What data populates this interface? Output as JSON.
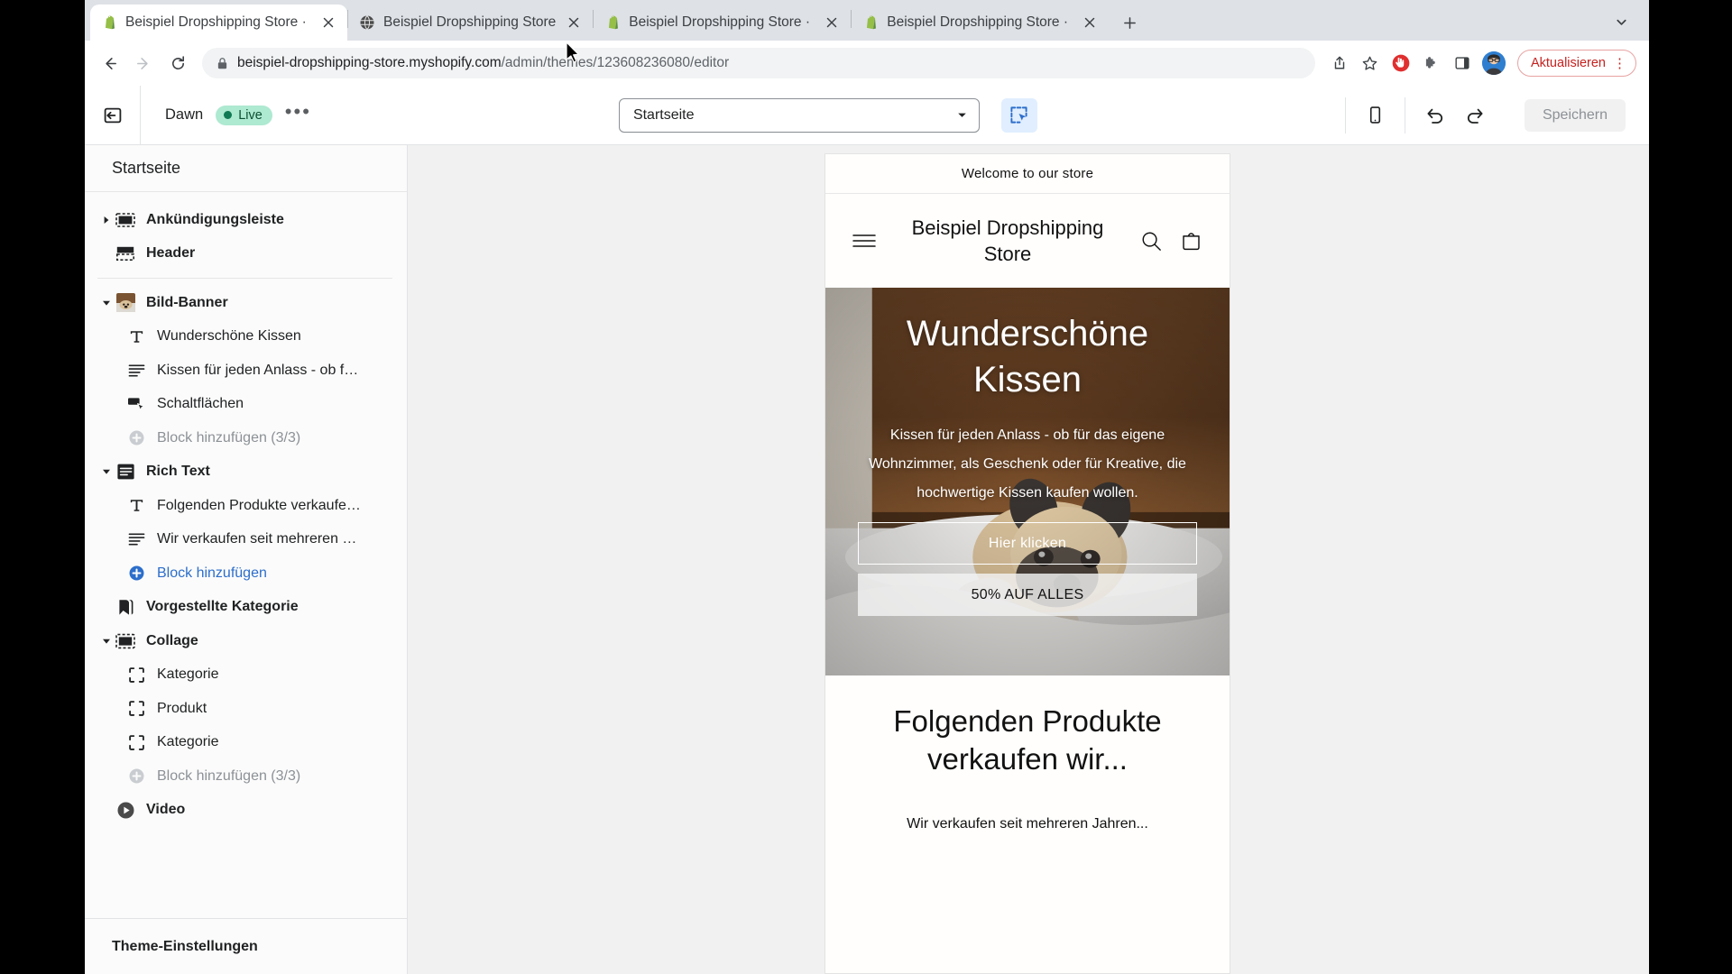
{
  "browser": {
    "tabs": [
      {
        "title": "Beispiel Dropshipping Store · D",
        "title_main": "Beispiel Dropshipping Store · ",
        "title_dim": "D",
        "favicon": "shopify-icon",
        "active": true
      },
      {
        "title": "Beispiel Dropshipping Store",
        "title_main": "Beispiel Dropshipping Store",
        "title_dim": "",
        "favicon": "globe-icon",
        "active": false
      },
      {
        "title": "Beispiel Dropshipping Store · S",
        "title_main": "Beispiel Dropshipping Store · ",
        "title_dim": "S",
        "favicon": "shopify-icon",
        "active": false
      },
      {
        "title": "Beispiel Dropshipping Store · B",
        "title_main": "Beispiel Dropshipping Store · ",
        "title_dim": "B",
        "favicon": "shopify-icon",
        "active": false
      }
    ],
    "new_tab_label": "+",
    "url_domain": "beispiel-dropshipping-store.myshopify.com",
    "url_path": "/admin/themes/123608236080/editor",
    "update_button_label": "Aktualisieren",
    "kebab_label": "⋮",
    "icons": {
      "back": "back-arrow-icon",
      "forward": "forward-arrow-icon",
      "reload": "reload-icon",
      "lock": "lock-icon",
      "share": "share-icon",
      "bookmark": "star-icon",
      "adblock": "adblock-icon",
      "extensions": "puzzle-icon",
      "sidepanel": "side-panel-icon",
      "profile": "avatar",
      "tab_list": "chevron-down-icon"
    }
  },
  "editor": {
    "theme_name": "Dawn",
    "live_badge": "Live",
    "more_label": "•••",
    "page_selector": {
      "value": "Startseite"
    },
    "save_label": "Speichern",
    "colors": {
      "live_badge_bg": "#aee9d1",
      "live_badge_text": "#0c5132",
      "inspector_active_bg": "#e0eeff",
      "link_blue": "#2c6ecb",
      "muted_text": "#8c9196"
    }
  },
  "sidebar": {
    "title": "Startseite",
    "footer_label": "Theme-Einstellungen",
    "items": [
      {
        "label": "Ankündigungsleiste",
        "icon": "announcement-bar-icon",
        "type": "section",
        "caret": "collapsed",
        "state": "normal"
      },
      {
        "label": "Header",
        "icon": "header-icon",
        "type": "section",
        "caret": "none",
        "state": "normal"
      },
      {
        "label": "__divider__",
        "icon": "",
        "type": "divider",
        "caret": "none",
        "state": "normal"
      },
      {
        "label": "Bild-Banner",
        "icon": "image-banner-icon",
        "type": "section",
        "caret": "expanded",
        "state": "normal"
      },
      {
        "label": "Wunderschöne Kissen",
        "icon": "heading-icon",
        "type": "block",
        "caret": "none",
        "state": "normal"
      },
      {
        "label": "Kissen für jeden Anlass - ob f…",
        "icon": "text-icon",
        "type": "block",
        "caret": "none",
        "state": "normal"
      },
      {
        "label": "Schaltflächen",
        "icon": "buttons-icon",
        "type": "block",
        "caret": "none",
        "state": "normal"
      },
      {
        "label": "Block hinzufügen (3/3)",
        "icon": "plus-circle-icon",
        "type": "block",
        "caret": "none",
        "state": "muted"
      },
      {
        "label": "Rich Text",
        "icon": "rich-text-icon",
        "type": "section",
        "caret": "expanded",
        "state": "normal"
      },
      {
        "label": "Folgenden Produkte verkaufe…",
        "icon": "heading-icon",
        "type": "block",
        "caret": "none",
        "state": "normal"
      },
      {
        "label": "Wir verkaufen seit mehreren …",
        "icon": "text-icon",
        "type": "block",
        "caret": "none",
        "state": "normal"
      },
      {
        "label": "Block hinzufügen",
        "icon": "plus-circle-blue-icon",
        "type": "block",
        "caret": "none",
        "state": "link"
      },
      {
        "label": "Vorgestellte Kategorie",
        "icon": "tag-icon",
        "type": "section",
        "caret": "none",
        "state": "normal"
      },
      {
        "label": "Collage",
        "icon": "collage-icon",
        "type": "section",
        "caret": "expanded",
        "state": "normal"
      },
      {
        "label": "Kategorie",
        "icon": "frame-icon",
        "type": "block",
        "caret": "none",
        "state": "normal"
      },
      {
        "label": "Produkt",
        "icon": "frame-icon",
        "type": "block",
        "caret": "none",
        "state": "normal"
      },
      {
        "label": "Kategorie",
        "icon": "frame-icon",
        "type": "block",
        "caret": "none",
        "state": "normal"
      },
      {
        "label": "Block hinzufügen (3/3)",
        "icon": "plus-circle-icon",
        "type": "block",
        "caret": "none",
        "state": "muted"
      },
      {
        "label": "Video",
        "icon": "video-icon",
        "type": "section",
        "caret": "none",
        "state": "normal"
      }
    ]
  },
  "preview": {
    "announcement": "Welcome to our store",
    "store_name": "Beispiel Dropshipping Store",
    "header_icons": {
      "menu": "hamburger-icon",
      "search": "search-icon",
      "cart": "cart-icon"
    },
    "hero": {
      "title": "Wunderschöne Kissen",
      "subtitle": "Kissen für jeden Anlass - ob für das eigene Wohnzimmer, als Geschenk oder für Kreative, die hochwertige Kissen kaufen wollen.",
      "button_primary": "Hier klicken",
      "button_secondary": "50% AUF ALLES"
    },
    "rich_text": {
      "title": "Folgenden Produkte verkaufen wir...",
      "body": "Wir verkaufen seit mehreren Jahren..."
    }
  }
}
